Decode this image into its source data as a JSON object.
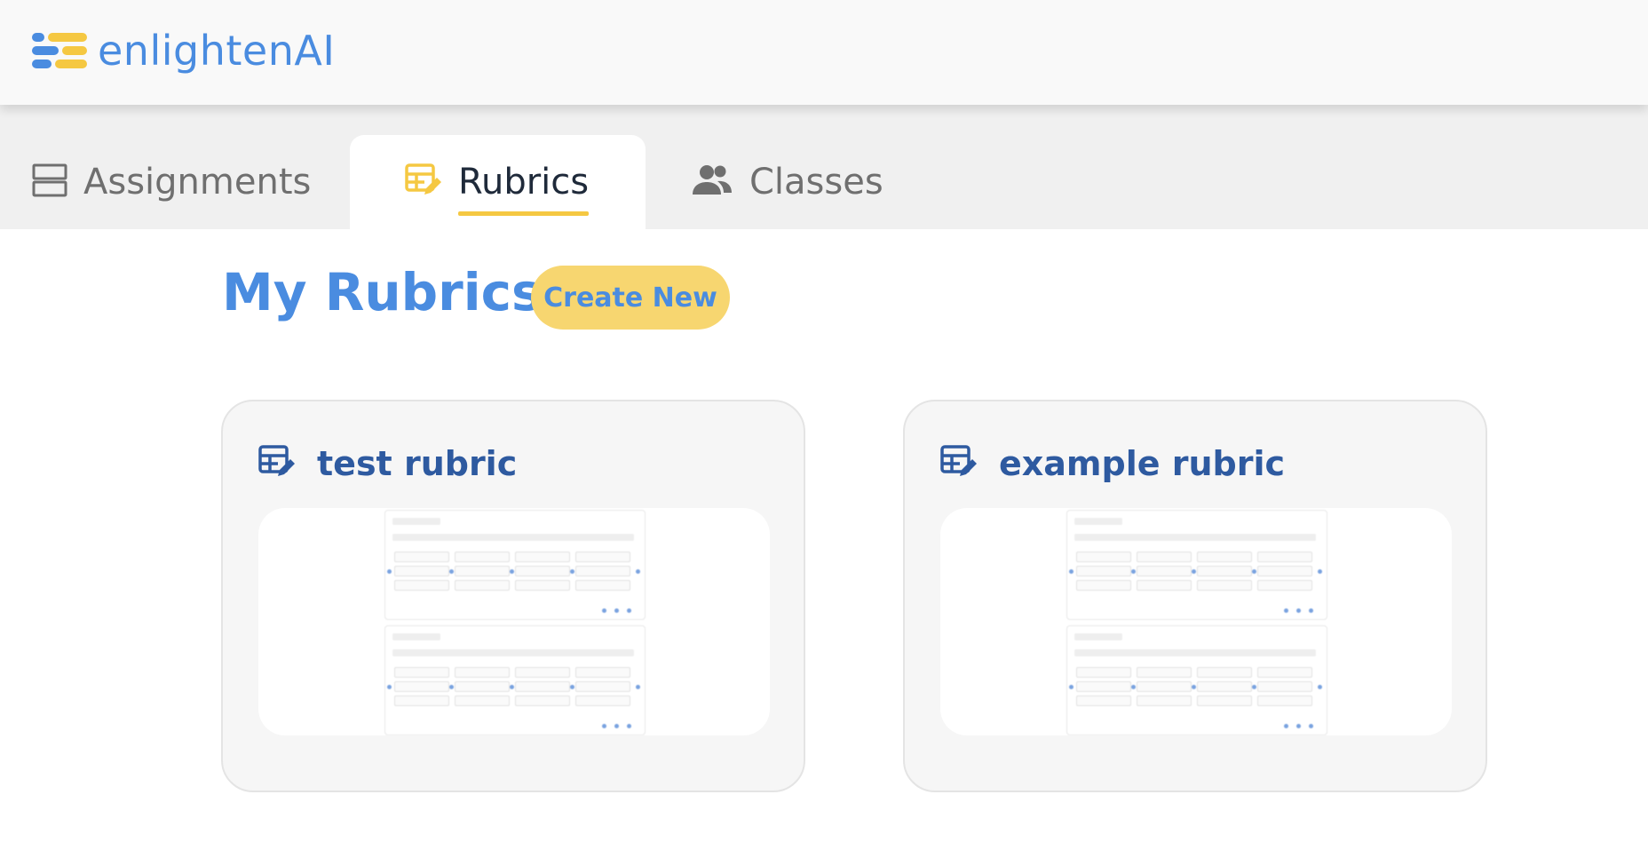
{
  "brand": {
    "name": "enlightenAI"
  },
  "tabs": [
    {
      "label": "Assignments",
      "icon": "assignments-icon",
      "active": false
    },
    {
      "label": "Rubrics",
      "icon": "rubric-edit-icon",
      "active": true
    },
    {
      "label": "Classes",
      "icon": "people-icon",
      "active": false
    }
  ],
  "main": {
    "title": "My Rubrics",
    "create_label": "Create New"
  },
  "rubrics": [
    {
      "title": "test rubric",
      "icon": "rubric-edit-icon"
    },
    {
      "title": "example rubric",
      "icon": "rubric-edit-icon"
    }
  ],
  "colors": {
    "brand_blue": "#4a8ce0",
    "accent_yellow": "#f7d670",
    "card_title": "#2e5aa0"
  }
}
